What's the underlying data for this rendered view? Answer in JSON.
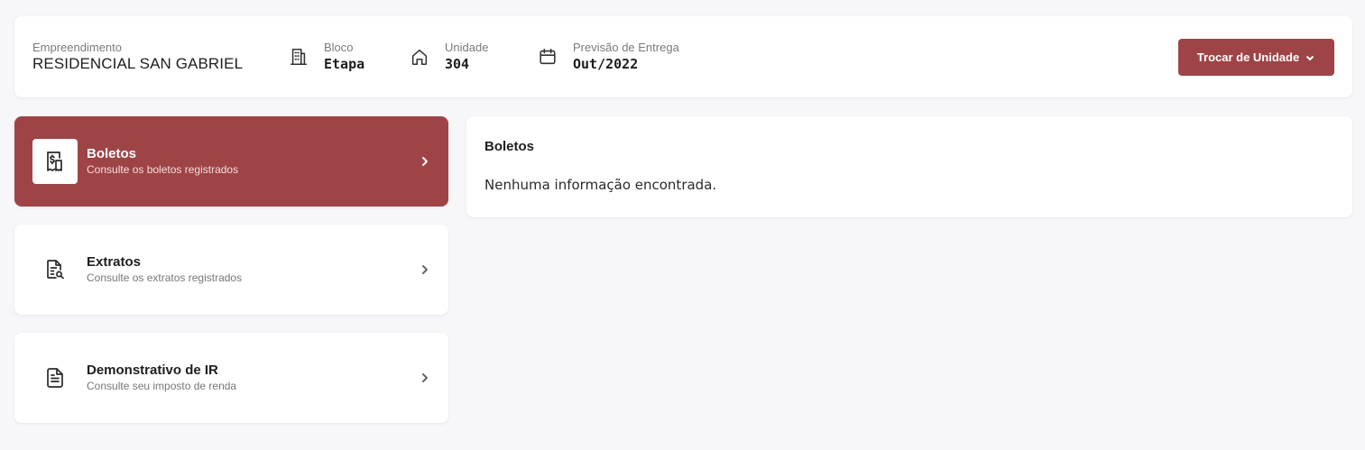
{
  "header": {
    "empreendimento": {
      "label": "Empreendimento",
      "value": "RESIDENCIAL SAN GABRIEL"
    },
    "bloco": {
      "label": "Bloco",
      "value": "Etapa",
      "icon": "building-icon"
    },
    "unidade": {
      "label": "Unidade",
      "value": "304",
      "icon": "home-icon"
    },
    "previsao": {
      "label": "Previsão de Entrega",
      "value": "Out/2022",
      "icon": "calendar-icon"
    },
    "button_label": "Trocar de Unidade"
  },
  "menu": [
    {
      "title": "Boletos",
      "subtitle": "Consulte os boletos registrados",
      "icon": "receipt-dollar-icon",
      "active": true
    },
    {
      "title": "Extratos",
      "subtitle": "Consulte os extratos registrados",
      "icon": "document-search-icon",
      "active": false
    },
    {
      "title": "Demonstrativo de IR",
      "subtitle": "Consulte seu imposto de renda",
      "icon": "document-icon",
      "active": false
    }
  ],
  "content": {
    "title": "Boletos",
    "message": "Nenhuma informação encontrada."
  },
  "colors": {
    "accent": "#9e4446",
    "background": "#f7f7f9",
    "card": "#ffffff"
  }
}
